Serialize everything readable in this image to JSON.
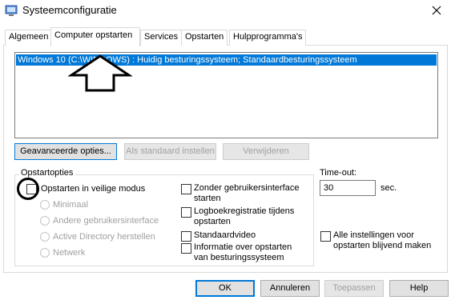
{
  "window": {
    "title": "Systeemconfiguratie",
    "app_icon": "msconfig-icon",
    "close_icon": "close-icon"
  },
  "tabs": [
    {
      "label": "Algemeen"
    },
    {
      "label": "Computer opstarten",
      "active": true
    },
    {
      "label": "Services"
    },
    {
      "label": "Opstarten"
    },
    {
      "label": "Hulpprogramma's"
    }
  ],
  "boot": {
    "os_entries": [
      {
        "label": "Windows 10 (C:\\WINDOWS) : Huidig besturingssysteem; Standaardbesturingssysteem",
        "selected": true
      }
    ],
    "buttons": {
      "advanced": "Geavanceerde opties...",
      "set_default": "Als standaard instellen",
      "delete": "Verwijderen"
    }
  },
  "options": {
    "group_label": "Opstartopties",
    "safe_boot": {
      "label": "Opstarten in veilige modus",
      "checked": false
    },
    "safe_modes": [
      {
        "label": "Minimaal"
      },
      {
        "label": "Andere gebruikersinterface"
      },
      {
        "label": "Active Directory herstellen"
      },
      {
        "label": "Netwerk"
      }
    ],
    "no_gui": {
      "line1": "Zonder gebruikersinterface",
      "line2": "starten",
      "checked": false
    },
    "boot_log": {
      "line1": "Logboekregistratie tijdens",
      "line2": "opstarten",
      "checked": false
    },
    "base_video": {
      "label": "Standaardvideo",
      "checked": false
    },
    "os_info": {
      "line1": "Informatie over opstarten",
      "line2": "van besturingssysteem",
      "checked": false
    }
  },
  "timeout": {
    "label": "Time-out:",
    "value": "30",
    "unit": "sec."
  },
  "permanent": {
    "line1": "Alle instellingen voor",
    "line2": "opstarten blijvend maken",
    "checked": false
  },
  "footer": {
    "ok": "OK",
    "cancel": "Annuleren",
    "apply": "Toepassen",
    "help": "Help"
  },
  "colors": {
    "selection": "#0078d7",
    "disabled_text": "#a0a0a0"
  }
}
